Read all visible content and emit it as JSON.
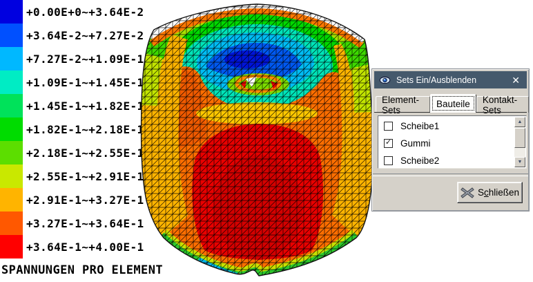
{
  "legend": {
    "title": "SPANNUNGEN PRO ELEMENT",
    "entries": [
      {
        "color": "#0000E0",
        "label": "+0.00E+0~+3.64E-2"
      },
      {
        "color": "#0050FF",
        "label": "+3.64E-2~+7.27E-2"
      },
      {
        "color": "#00B8FF",
        "label": "+7.27E-2~+1.09E-1"
      },
      {
        "color": "#00ECC4",
        "label": "+1.09E-1~+1.45E-1"
      },
      {
        "color": "#00E25A",
        "label": "+1.45E-1~+1.82E-1"
      },
      {
        "color": "#00DC00",
        "label": "+1.82E-1~+2.18E-1"
      },
      {
        "color": "#5CDE00",
        "label": "+2.18E-1~+2.55E-1"
      },
      {
        "color": "#C9E800",
        "label": "+2.55E-1~+2.91E-1"
      },
      {
        "color": "#FFB400",
        "label": "+2.91E-1~+3.27E-1"
      },
      {
        "color": "#FF5800",
        "label": "+3.27E-1~+3.64E-1"
      },
      {
        "color": "#FF0000",
        "label": "+3.64E-1~+4.00E-1"
      }
    ]
  },
  "dialog": {
    "title": "Sets Ein/Ausblenden",
    "close_symbol": "✕",
    "checkmark": "✓",
    "scrollbar": {
      "up": "▲",
      "down": "▼"
    },
    "tabs": [
      {
        "label": "Element-Sets",
        "active": false
      },
      {
        "label": "Bauteile",
        "active": true
      },
      {
        "label": "Kontakt-Sets",
        "active": false
      }
    ],
    "items": [
      {
        "label": "Scheibe1",
        "checked": false
      },
      {
        "label": "Gummi",
        "checked": true
      },
      {
        "label": "Scheibe2",
        "checked": false
      }
    ],
    "close_button": {
      "pre": "S",
      "mnemonic": "c",
      "post": "hließen"
    }
  },
  "mesh": {
    "palette": {
      "side_yellow": "#FFB400",
      "side_yellow_green": "#C2E400",
      "side_green": "#3CD800",
      "top_yellow_green": "#A6E000",
      "top_green": "#00D800",
      "top_teal": "#00E4B8",
      "top_cyan": "#00BCF4",
      "top_blue": "#0058F0",
      "top_deep_blue": "#0014D8",
      "front_orange": "#FF6E00",
      "front_dark_orange": "#F05A00",
      "red": "#E80000",
      "dark_red": "#D40000",
      "yellow_band": "#FFC800",
      "bottom_yellow_green": "#C8E000",
      "bottom_green": "#2CC82C",
      "bottom_cyan": "#00B4E8",
      "bottom_blue": "#2854E8",
      "rim_orange": "#FF7800",
      "rim_white": "#FFFFFF",
      "hub_green": "#7CDC00",
      "hub_orange": "#FF8C00"
    }
  }
}
